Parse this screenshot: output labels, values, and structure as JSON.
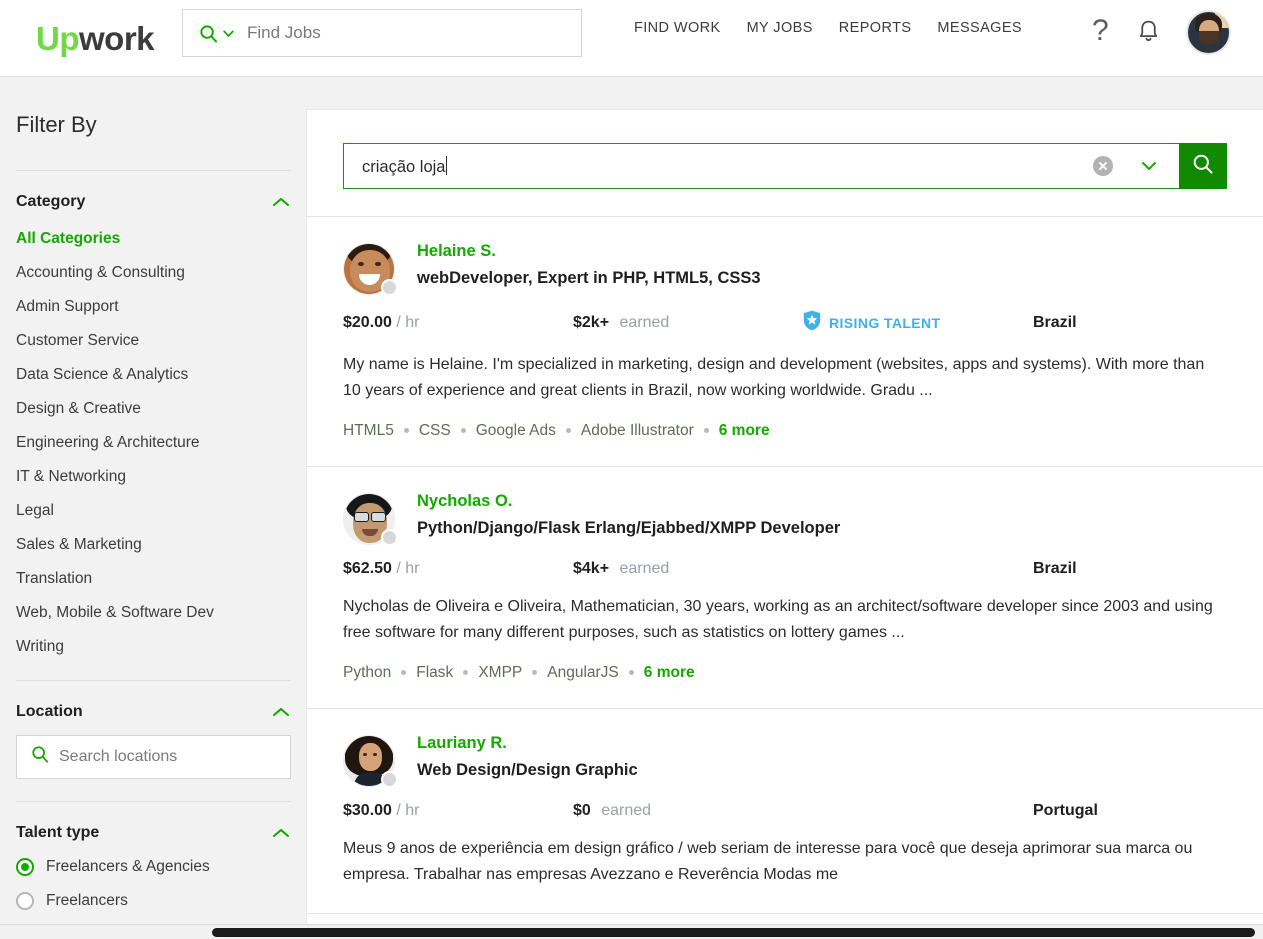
{
  "header": {
    "logo_up": "Up",
    "logo_work": "work",
    "find_jobs_placeholder": "Find Jobs",
    "nav_items": [
      {
        "label": "FIND WORK"
      },
      {
        "label": "MY JOBS"
      },
      {
        "label": "REPORTS"
      },
      {
        "label": "MESSAGES"
      }
    ],
    "help_glyph": "?",
    "icons": {
      "search": "search-icon",
      "chevron": "chevron-down-icon",
      "bell": "notifications-bell-icon",
      "avatar": "user-avatar"
    }
  },
  "sidebar": {
    "title": "Filter By",
    "category": {
      "heading": "Category",
      "items": [
        {
          "label": "All Categories",
          "active": true
        },
        {
          "label": "Accounting & Consulting",
          "active": false
        },
        {
          "label": "Admin Support",
          "active": false
        },
        {
          "label": "Customer Service",
          "active": false
        },
        {
          "label": "Data Science & Analytics",
          "active": false
        },
        {
          "label": "Design & Creative",
          "active": false
        },
        {
          "label": "Engineering & Architecture",
          "active": false
        },
        {
          "label": "IT & Networking",
          "active": false
        },
        {
          "label": "Legal",
          "active": false
        },
        {
          "label": "Sales & Marketing",
          "active": false
        },
        {
          "label": "Translation",
          "active": false
        },
        {
          "label": "Web, Mobile & Software Dev",
          "active": false
        },
        {
          "label": "Writing",
          "active": false
        }
      ]
    },
    "location": {
      "heading": "Location",
      "search_placeholder": "Search locations"
    },
    "talent_type": {
      "heading": "Talent type",
      "options": [
        {
          "label": "Freelancers & Agencies",
          "selected": true
        },
        {
          "label": "Freelancers",
          "selected": false
        }
      ]
    }
  },
  "search": {
    "query": "criação loja",
    "clear_label": "clear-search",
    "dropdown_label": "search-options",
    "submit_label": "search"
  },
  "results": [
    {
      "name": "Helaine S.",
      "title": "webDeveloper, Expert in PHP, HTML5, CSS3",
      "rate": "$20.00",
      "rate_unit": "/ hr",
      "earned_amount": "$2k+",
      "earned_label": "earned",
      "badge": "RISING TALENT",
      "country": "Brazil",
      "description": "My name is Helaine. I'm specialized in marketing, design and development (websites, apps and systems). With more than 10 years of experience and great clients in Brazil, now working worldwide. Gradu ...",
      "skills": [
        "HTML5",
        "CSS",
        "Google Ads",
        "Adobe Illustrator"
      ],
      "more_skills": "6 more"
    },
    {
      "name": "Nycholas O.",
      "title": "Python/Django/Flask Erlang/Ejabbed/XMPP Developer",
      "rate": "$62.50",
      "rate_unit": "/ hr",
      "earned_amount": "$4k+",
      "earned_label": "earned",
      "badge": "",
      "country": "Brazil",
      "description": "Nycholas de Oliveira e Oliveira, Mathematician, 30 years, working as an architect/software developer since 2003 and using free software for many different purposes, such as statistics on lottery games ...",
      "skills": [
        "Python",
        "Flask",
        "XMPP",
        "AngularJS"
      ],
      "more_skills": "6 more"
    },
    {
      "name": "Lauriany R.",
      "title": "Web Design/Design Graphic",
      "rate": "$30.00",
      "rate_unit": "/ hr",
      "earned_amount": "$0",
      "earned_label": "earned",
      "badge": "",
      "country": "Portugal",
      "description": "Meus 9 anos de experiência em design gráfico / web seriam de interesse para você que deseja aprimorar sua marca ou empresa. Trabalhar nas empresas Avezzano e Reverência Modas me",
      "skills": [],
      "more_skills": ""
    }
  ],
  "colors": {
    "brand_green": "#14a800",
    "logo_green": "#6fda44",
    "button_green": "#108a00",
    "badge_blue": "#3fb1e8",
    "page_bg": "#f2f2f2"
  }
}
